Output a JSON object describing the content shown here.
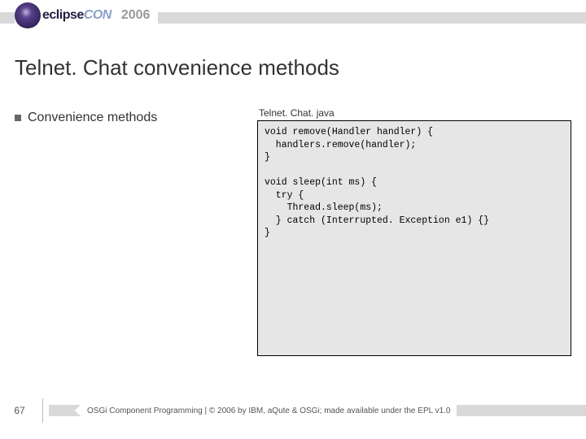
{
  "header": {
    "logo_part1": "eclipse",
    "logo_part2": "CON",
    "year": "2006"
  },
  "title": "Telnet. Chat convenience methods",
  "bullet": "Convenience methods",
  "code": {
    "caption": "Telnet. Chat. java",
    "body": "void remove(Handler handler) {\n  handlers.remove(handler);\n}\n\nvoid sleep(int ms) {\n  try {\n    Thread.sleep(ms);\n  } catch (Interrupted. Exception e1) {}\n}"
  },
  "footer": {
    "slide": "67",
    "text": "OSGi Component Programming | © 2006 by IBM, aQute & OSGi; made available under the EPL v1.0"
  }
}
